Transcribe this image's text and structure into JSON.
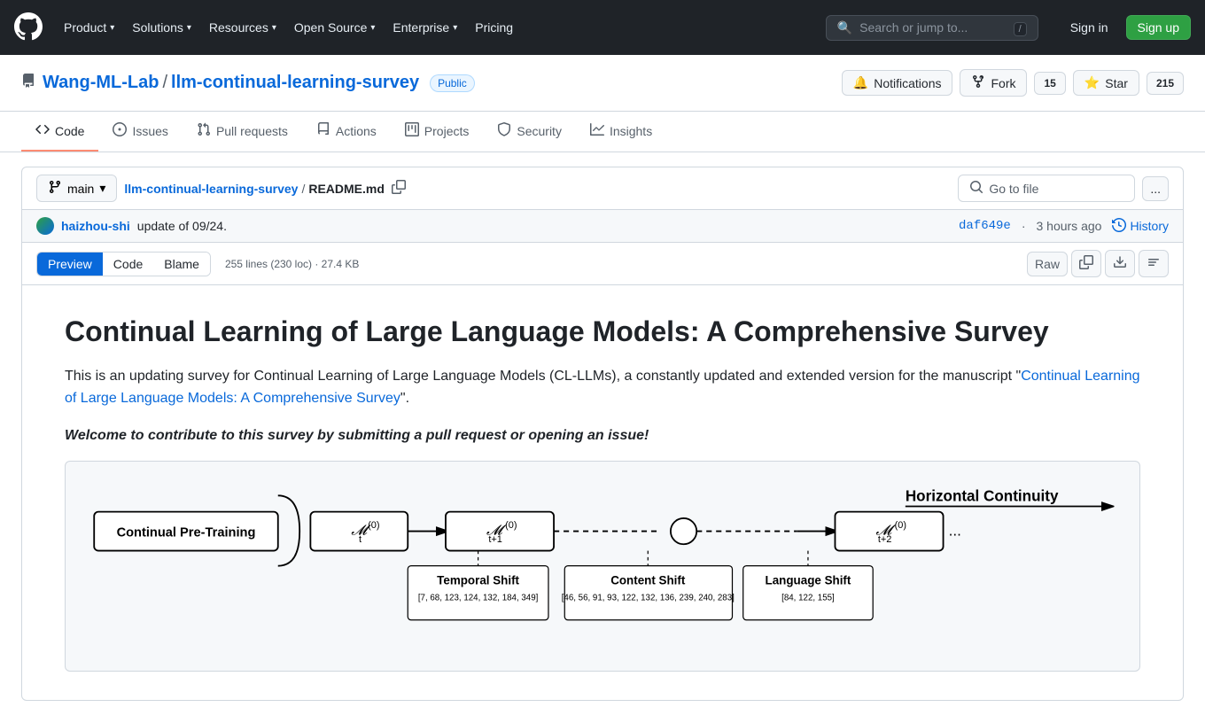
{
  "nav": {
    "logo_label": "GitHub",
    "links": [
      {
        "label": "Product",
        "has_chevron": true
      },
      {
        "label": "Solutions",
        "has_chevron": true
      },
      {
        "label": "Resources",
        "has_chevron": true
      },
      {
        "label": "Open Source",
        "has_chevron": true
      },
      {
        "label": "Enterprise",
        "has_chevron": true
      },
      {
        "label": "Pricing",
        "has_chevron": false
      }
    ],
    "search_placeholder": "Search or jump to...",
    "search_shortcut": "/",
    "signin_label": "Sign in",
    "signup_label": "Sign up"
  },
  "repo": {
    "owner": "Wang-ML-Lab",
    "separator": "/",
    "name": "llm-continual-learning-survey",
    "visibility": "Public",
    "notifications_label": "Notifications",
    "fork_label": "Fork",
    "fork_count": "15",
    "star_label": "Star",
    "star_count": "215"
  },
  "tabs": [
    {
      "label": "Code",
      "icon": "code",
      "active": true
    },
    {
      "label": "Issues",
      "icon": "issue"
    },
    {
      "label": "Pull requests",
      "icon": "pr"
    },
    {
      "label": "Actions",
      "icon": "actions"
    },
    {
      "label": "Projects",
      "icon": "projects"
    },
    {
      "label": "Security",
      "icon": "shield"
    },
    {
      "label": "Insights",
      "icon": "graph"
    }
  ],
  "file_header": {
    "branch": "main",
    "path_repo": "llm-continual-learning-survey",
    "path_sep": "/",
    "path_file": "README.md",
    "goto_label": "Go to file",
    "more_icon": "..."
  },
  "commit": {
    "user": "haizhou-shi",
    "message": "update of 09/24.",
    "hash": "daf649e",
    "time": "3 hours ago",
    "history_label": "History"
  },
  "file_actions": {
    "view_tabs": [
      {
        "label": "Preview",
        "active": true
      },
      {
        "label": "Code",
        "active": false
      },
      {
        "label": "Blame",
        "active": false
      }
    ],
    "meta": "255 lines (230 loc) · 27.4 KB",
    "raw_label": "Raw",
    "copy_icon": "copy",
    "download_icon": "download",
    "list_icon": "list"
  },
  "readme": {
    "title": "Continual Learning of Large Language Models: A Comprehensive Survey",
    "para1_start": "This is an updating survey for Continual Learning of Large Language Models (CL-LLMs), a constantly updated and extended version for the manuscript \"",
    "para1_link_text": "Continual Learning of Large Language Models: A Comprehensive Survey",
    "para1_end": "\".",
    "para2": "Welcome to contribute to this survey by submitting a pull request or opening an issue!"
  },
  "diagram": {
    "title": "Continual Pre-Training",
    "horizontal_label": "Horizontal Continuity",
    "temporal_label": "Temporal Shift",
    "temporal_refs": "[7, 68, 123, 124, 132, 184, 349]",
    "content_label": "Content Shift",
    "content_refs": "[46, 56, 91, 93, 122, 132, 136, 239, 240, 283]",
    "language_label": "Language Shift",
    "language_refs": "[84, 122, 155]"
  }
}
